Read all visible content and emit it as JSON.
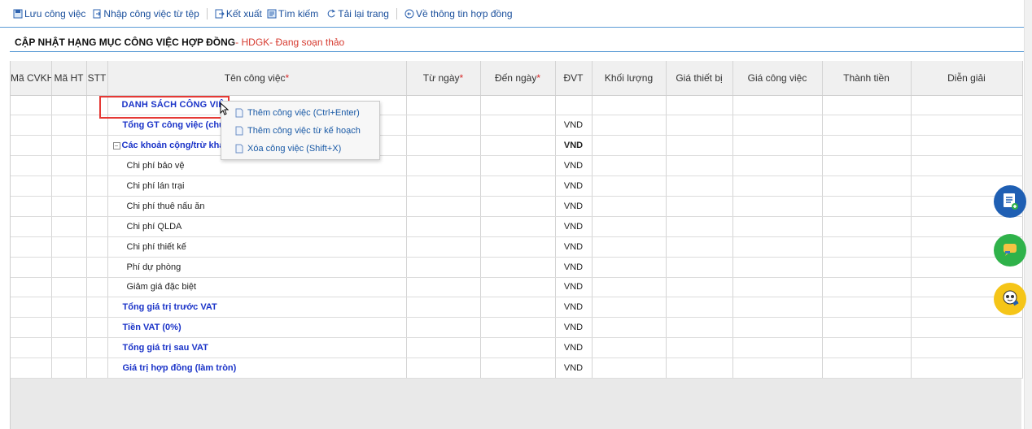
{
  "toolbar": {
    "save": "Lưu công việc",
    "import": "Nhập công việc từ tệp",
    "export": "Kết xuất",
    "search": "Tìm kiếm",
    "reload": "Tải lại trang",
    "back": "Về thông tin hợp đồng"
  },
  "title": {
    "main": "CẬP NHẬT HẠNG MỤC CÔNG VIỆC HỢP ĐỒNG",
    "code": " - HDGK",
    "status": " - Đang soạn thảo"
  },
  "columns": {
    "ma_cvkh": "Mã CVKH",
    "ma_ht": "Mã HT",
    "stt": "STT",
    "ten": "Tên công việc",
    "tu_ngay": "Từ ngày",
    "den_ngay": "Đến ngày",
    "dvt": "ĐVT",
    "khoi_luong": "Khối lượng",
    "gia_tb": "Giá thiết bị",
    "gia_cv": "Giá công việc",
    "thanh_tien": "Thành tiền",
    "dien_giai": "Diễn giải",
    "required_mark": "*"
  },
  "rows": [
    {
      "name": "DANH SÁCH CÔNG VIỆC",
      "unit": ""
    },
    {
      "name": "Tổng GT công việc (chưa",
      "unit": "VND"
    },
    {
      "name": "Các khoản cộng/trừ khác",
      "unit": "VND",
      "toggle": "−"
    },
    {
      "name": "Chi phí bảo vệ",
      "unit": "VND"
    },
    {
      "name": "Chi phí lán trại",
      "unit": "VND"
    },
    {
      "name": "Chi phí thuê nấu ăn",
      "unit": "VND"
    },
    {
      "name": "Chi phí QLDA",
      "unit": "VND"
    },
    {
      "name": "Chi phí thiết kế",
      "unit": "VND"
    },
    {
      "name": "Phí dự phòng",
      "unit": "VND"
    },
    {
      "name": "Giảm giá đặc biệt",
      "unit": "VND"
    },
    {
      "name": "Tổng giá trị trước VAT",
      "unit": "VND"
    },
    {
      "name": "Tiền VAT (0%)",
      "unit": "VND"
    },
    {
      "name": "Tổng giá trị sau VAT",
      "unit": "VND"
    },
    {
      "name": "Giá trị hợp đồng (làm tròn)",
      "unit": "VND"
    }
  ],
  "context_menu": {
    "add": "Thêm công việc (Ctrl+Enter)",
    "add_from_plan": "Thêm công việc từ kế hoạch",
    "delete": "Xóa công việc (Shift+X)"
  },
  "icons": {
    "fab1": "task-list-add-icon",
    "fab2": "chat-icon",
    "fab3": "robot-assistant-icon"
  },
  "colors": {
    "link_blue": "#1a4f9c",
    "bold_blue": "#1a33c8",
    "status_red": "#d63a2f",
    "highlight_red": "#e53935"
  }
}
